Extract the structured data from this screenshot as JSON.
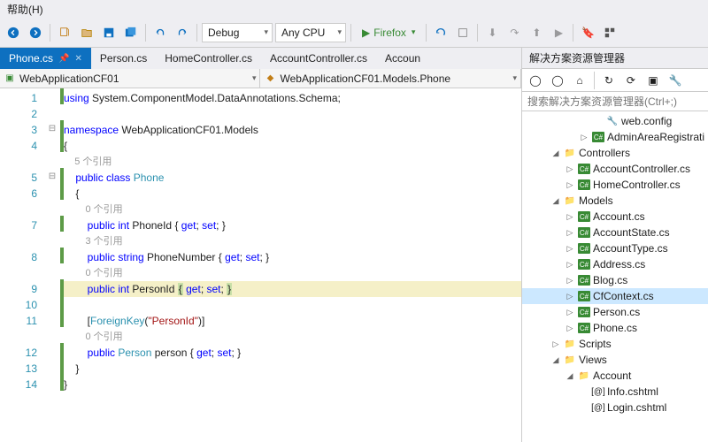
{
  "menu": {
    "help": "帮助(H)"
  },
  "toolbar": {
    "debug": "Debug",
    "cpu": "Any CPU",
    "run": "Firefox"
  },
  "tabs": [
    {
      "label": "Phone.cs",
      "active": true,
      "pinned": true
    },
    {
      "label": "Person.cs"
    },
    {
      "label": "HomeController.cs"
    },
    {
      "label": "AccountController.cs"
    },
    {
      "label": "Accoun"
    }
  ],
  "nav": {
    "project": "WebApplicationCF01",
    "scope": "WebApplicationCF01.Models.Phone"
  },
  "code": {
    "lines": [
      "1",
      "2",
      "3",
      "4",
      "",
      "5",
      "6",
      "",
      "7",
      "",
      "8",
      "",
      "9",
      "10",
      "11",
      "",
      "12",
      "13",
      "14"
    ],
    "l1_kw": "using",
    "l1_ns": " System.ComponentModel.DataAnnotations.Schema;",
    "l3_kw": "namespace",
    "l3_ns": " WebApplicationCF01.Models",
    "l4": "{",
    "ref5": "    5 个引用",
    "l5a": "    ",
    "l5_kw1": "public",
    "l5b": " ",
    "l5_kw2": "class",
    "l5c": " ",
    "l5_type": "Phone",
    "l6": "    {",
    "ref0a": "        0 个引用",
    "l7a": "        ",
    "l7_kw1": "public",
    "l7b": " ",
    "l7_kw2": "int",
    "l7c": " PhoneId { ",
    "l7_kw3": "get",
    "l7d": "; ",
    "l7_kw4": "set",
    "l7e": "; }",
    "ref3": "        3 个引用",
    "l8a": "        ",
    "l8_kw1": "public",
    "l8b": " ",
    "l8_kw2": "string",
    "l8c": " PhoneNumber { ",
    "l8_kw3": "get",
    "l8d": "; ",
    "l8_kw4": "set",
    "l8e": "; }",
    "ref0b": "        0 个引用",
    "l9a": "        ",
    "l9_kw1": "public",
    "l9b": " ",
    "l9_kw2": "int",
    "l9c": " PersonId ",
    "l9_b1": "{",
    "l9d": " ",
    "l9_kw3": "get",
    "l9e": "; ",
    "l9_kw4": "set",
    "l9f": "; ",
    "l9_b2": "}",
    "l11a": "        [",
    "l11_type": "ForeignKey",
    "l11b": "(",
    "l11_str": "\"PersonId\"",
    "l11c": ")]",
    "ref0c": "        0 个引用",
    "l12a": "        ",
    "l12_kw1": "public",
    "l12b": " ",
    "l12_type": "Person",
    "l12c": " person { ",
    "l12_kw3": "get",
    "l12d": "; ",
    "l12_kw4": "set",
    "l12e": "; }",
    "l13": "    }",
    "l14": "}"
  },
  "solution": {
    "title": "解决方案资源管理器",
    "search_placeholder": "搜索解决方案资源管理器(Ctrl+;)",
    "items": {
      "webconfig": "web.config",
      "adminarea": "AdminAreaRegistrati",
      "controllers": "Controllers",
      "accountctrl": "AccountController.cs",
      "homectrl": "HomeController.cs",
      "models": "Models",
      "account": "Account.cs",
      "accountstate": "AccountState.cs",
      "accounttype": "AccountType.cs",
      "address": "Address.cs",
      "blog": "Blog.cs",
      "cfcontext": "CfContext.cs",
      "person": "Person.cs",
      "phone": "Phone.cs",
      "scripts": "Scripts",
      "views": "Views",
      "accountf": "Account",
      "info": "Info.cshtml",
      "login": "Login.cshtml"
    }
  }
}
